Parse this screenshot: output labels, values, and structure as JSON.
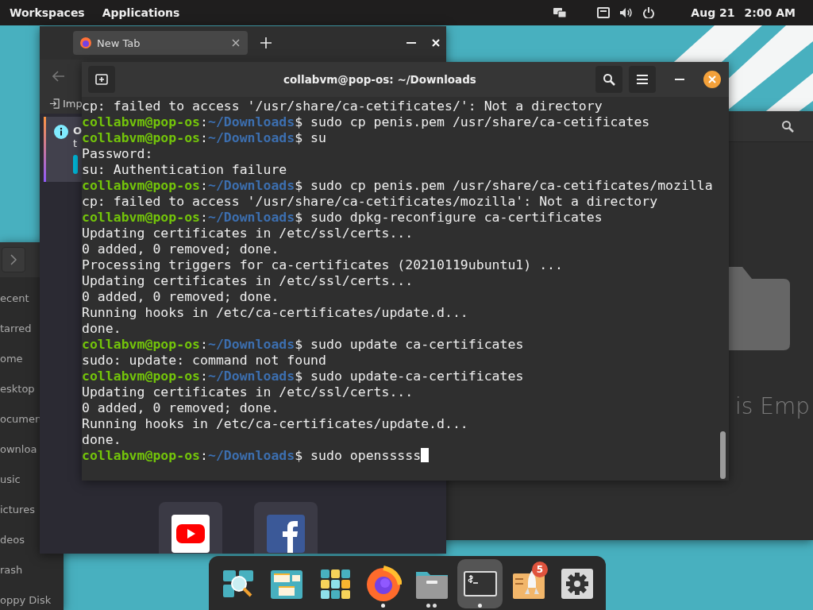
{
  "top_bar": {
    "menus": [
      {
        "label": "Workspaces"
      },
      {
        "label": "Applications"
      }
    ],
    "date": "Aug 21",
    "time": "2:00 AM"
  },
  "browser": {
    "tab": {
      "title": "New Tab",
      "selected": true
    },
    "bookmark": "Imp",
    "notification": {
      "line_1": "O",
      "line_2": "t"
    }
  },
  "files_left": {
    "sidebar": [
      "ecent",
      "tarred",
      "ome",
      "esktop",
      "ocumen",
      "ownloa",
      "usic",
      "ictures",
      "deos",
      "rash",
      "oppy Disk"
    ]
  },
  "files_right": {
    "empty_text": "is Emp"
  },
  "terminal": {
    "title": "collabvm@pop-os: ~/Downloads",
    "lines": [
      {
        "kind": "output",
        "text": "cp: failed to access '/usr/share/ca-cetificates/': Not a directory",
        "cursor": false
      },
      {
        "kind": "prompt",
        "user": "collabvm@pop-os",
        "sep": ":",
        "path": "~/Downloads",
        "text": "$ sudo cp penis.pem /usr/share/ca-cetificates",
        "cursor": false
      },
      {
        "kind": "prompt",
        "user": "collabvm@pop-os",
        "sep": ":",
        "path": "~/Downloads",
        "text": "$ su",
        "cursor": false
      },
      {
        "kind": "output",
        "text": "Password:",
        "cursor": false
      },
      {
        "kind": "output",
        "text": "su: Authentication failure",
        "cursor": false
      },
      {
        "kind": "prompt",
        "user": "collabvm@pop-os",
        "sep": ":",
        "path": "~/Downloads",
        "text": "$ sudo cp penis.pem /usr/share/ca-cetificates/mozilla",
        "cursor": false
      },
      {
        "kind": "output",
        "text": "cp: failed to access '/usr/share/ca-cetificates/mozilla': Not a directory",
        "cursor": false
      },
      {
        "kind": "prompt",
        "user": "collabvm@pop-os",
        "sep": ":",
        "path": "~/Downloads",
        "text": "$ sudo dpkg-reconfigure ca-certificates",
        "cursor": false
      },
      {
        "kind": "output",
        "text": "Updating certificates in /etc/ssl/certs...",
        "cursor": false
      },
      {
        "kind": "output",
        "text": "0 added, 0 removed; done.",
        "cursor": false
      },
      {
        "kind": "output",
        "text": "Processing triggers for ca-certificates (20210119ubuntu1) ...",
        "cursor": false
      },
      {
        "kind": "output",
        "text": "Updating certificates in /etc/ssl/certs...",
        "cursor": false
      },
      {
        "kind": "output",
        "text": "0 added, 0 removed; done.",
        "cursor": false
      },
      {
        "kind": "output",
        "text": "Running hooks in /etc/ca-certificates/update.d...",
        "cursor": false
      },
      {
        "kind": "output",
        "text": "done.",
        "cursor": false
      },
      {
        "kind": "prompt",
        "user": "collabvm@pop-os",
        "sep": ":",
        "path": "~/Downloads",
        "text": "$ sudo update ca-certificates",
        "cursor": false
      },
      {
        "kind": "output",
        "text": "sudo: update: command not found",
        "cursor": false
      },
      {
        "kind": "prompt",
        "user": "collabvm@pop-os",
        "sep": ":",
        "path": "~/Downloads",
        "text": "$ sudo update-ca-certificates",
        "cursor": false
      },
      {
        "kind": "output",
        "text": "Updating certificates in /etc/ssl/certs...",
        "cursor": false
      },
      {
        "kind": "output",
        "text": "0 added, 0 removed; done.",
        "cursor": false
      },
      {
        "kind": "output",
        "text": "Running hooks in /etc/ca-certificates/update.d...",
        "cursor": false
      },
      {
        "kind": "output",
        "text": "done.",
        "cursor": false
      },
      {
        "kind": "prompt",
        "user": "collabvm@pop-os",
        "sep": ":",
        "path": "~/Downloads",
        "text": "$ sudo opensssss",
        "cursor": true
      }
    ]
  },
  "dock": {
    "items": [
      {
        "kind": "search",
        "selected": false,
        "running": false
      },
      {
        "kind": "workspaces",
        "selected": false,
        "running": false
      },
      {
        "kind": "app-grid",
        "selected": false,
        "running": false
      },
      {
        "kind": "firefox",
        "selected": false,
        "running": true,
        "multiple_windows": false
      },
      {
        "kind": "files",
        "selected": false,
        "running": true,
        "multiple_windows": true
      },
      {
        "kind": "terminal",
        "selected": true,
        "running": true,
        "multiple_windows": false
      },
      {
        "kind": "shop",
        "selected": false,
        "running": false,
        "badge": "5"
      },
      {
        "kind": "settings",
        "selected": false,
        "running": false
      }
    ]
  }
}
